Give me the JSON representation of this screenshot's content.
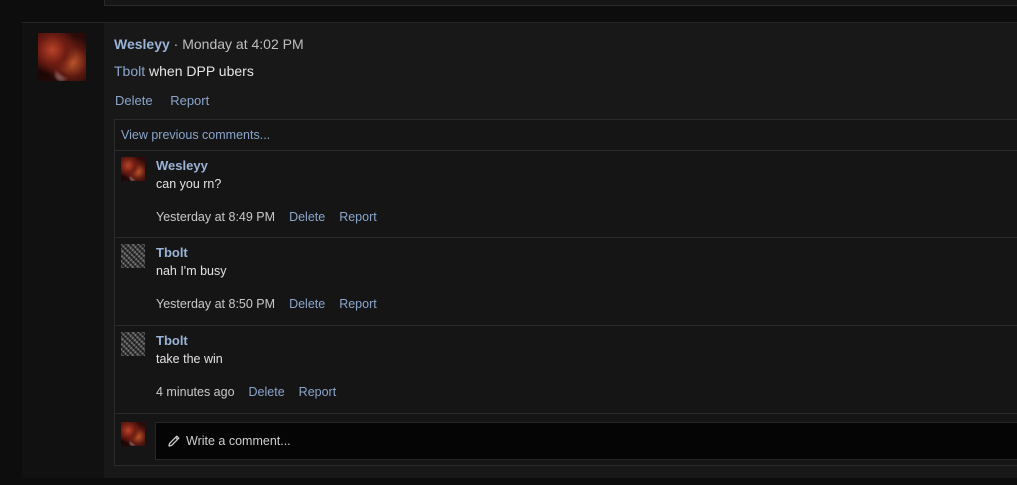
{
  "post": {
    "author": "Wesleyy",
    "separator": " · ",
    "time": "Monday at 4:02 PM",
    "mention": "Tbolt",
    "text": " when DPP ubers",
    "actions": {
      "delete": "Delete",
      "report": "Report"
    }
  },
  "comments": {
    "view_previous": "View previous comments...",
    "items": [
      {
        "author": "Wesleyy",
        "text": "can you rn?",
        "time": "Yesterday at 8:49 PM",
        "delete": "Delete",
        "report": "Report",
        "avatar": "flame-avatar"
      },
      {
        "author": "Tbolt",
        "text": "nah I'm busy",
        "time": "Yesterday at 8:50 PM",
        "delete": "Delete",
        "report": "Report",
        "avatar": "noise-avatar"
      },
      {
        "author": "Tbolt",
        "text": "take the win",
        "time": "4 minutes ago",
        "delete": "Delete",
        "report": "Report",
        "avatar": "noise-avatar"
      }
    ],
    "write_placeholder": "Write a comment..."
  },
  "colors": {
    "link": "#8aa6cc",
    "username": "#9bb3d6",
    "background": "#0d0d0d"
  }
}
